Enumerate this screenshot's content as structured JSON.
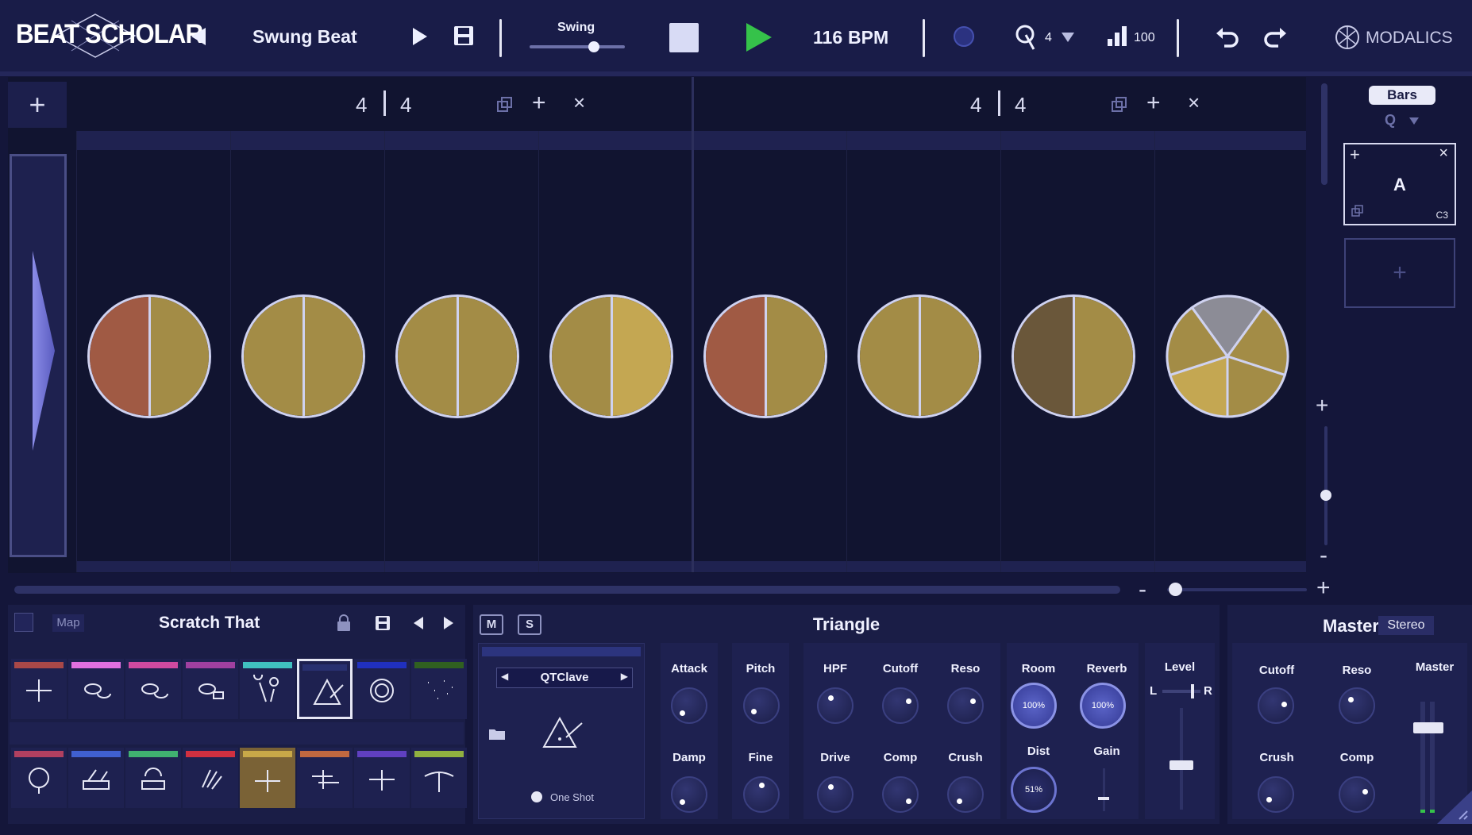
{
  "app": {
    "logo_text": "BEAT SCHOLAR",
    "pattern_name": "Swung Beat",
    "swing_label": "Swing",
    "bpm_value": "116",
    "bpm_unit": "BPM",
    "metronome_count": "4",
    "velocity_value": "100",
    "brand": "MODALICS"
  },
  "editor": {
    "bars": [
      {
        "numerator": "4",
        "denominator": "4"
      },
      {
        "numerator": "4",
        "denominator": "4"
      }
    ],
    "beats": [
      {
        "slices": [
          "#a05a44",
          "#a38c46"
        ]
      },
      {
        "slices": [
          "#a38c46",
          "#a38c46"
        ]
      },
      {
        "slices": [
          "#a38c46",
          "#a38c46"
        ]
      },
      {
        "slices": [
          "#a38c46",
          "#c4a752"
        ]
      },
      {
        "slices": [
          "#a05a44",
          "#a38c46"
        ]
      },
      {
        "slices": [
          "#a38c46",
          "#a38c46"
        ]
      },
      {
        "slices": [
          "#6a573a",
          "#a38c46"
        ]
      },
      {
        "slices": [
          "#8c8c96",
          "#a38c46",
          "#a38c46",
          "#c4a752",
          "#a38c46"
        ]
      }
    ]
  },
  "right_panel": {
    "mode_label": "Bars",
    "quantize_label": "Q",
    "section_name": "A",
    "section_note": "C3"
  },
  "kit": {
    "map_label": "Map",
    "kit_name": "Scratch That",
    "instrument_colors_row1": [
      "#a84848",
      "#e070e0",
      "#d04aa0",
      "#a040a0",
      "#40c0c0",
      "#283070",
      "#2030c0",
      "#306020"
    ],
    "instrument_colors_row2": [
      "#b04060",
      "#4060d0",
      "#40b070",
      "#d03040",
      "#c8a848",
      "#c06840",
      "#6040c0",
      "#90b040"
    ]
  },
  "instrument": {
    "mute_label": "M",
    "solo_label": "S",
    "name": "Triangle",
    "sample_name": "QTClave",
    "one_shot_label": "One Shot",
    "params": {
      "attack": "Attack",
      "damp": "Damp",
      "pitch": "Pitch",
      "fine": "Fine",
      "hpf": "HPF",
      "cutoff": "Cutoff",
      "reso": "Reso",
      "drive": "Drive",
      "comp": "Comp",
      "crush": "Crush",
      "room": "Room",
      "reverb": "Reverb",
      "dist": "Dist",
      "gain": "Gain",
      "level": "Level",
      "room_value": "100%",
      "reverb_value": "100%",
      "dist_value": "51%",
      "pan_left": "L",
      "pan_right": "R"
    }
  },
  "master": {
    "title": "Master",
    "output_mode": "Stereo",
    "cutoff": "Cutoff",
    "reso": "Reso",
    "crush": "Crush",
    "comp": "Comp",
    "master_label": "Master"
  }
}
